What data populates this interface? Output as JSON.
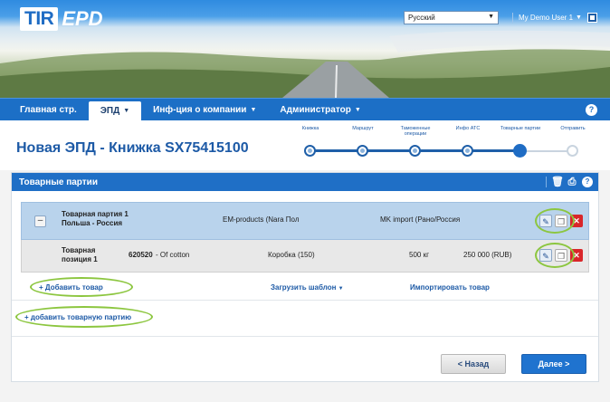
{
  "brand": {
    "logo_tir": "TIR",
    "logo_epd": "EPD"
  },
  "header": {
    "language": "Русский",
    "user_label": "My Demo User 1"
  },
  "nav": {
    "items": [
      {
        "label": "Главная стр.",
        "caret": ""
      },
      {
        "label": "ЭПД",
        "caret": "▼"
      },
      {
        "label": "Инф-ция о компании",
        "caret": "▼"
      },
      {
        "label": "Администратор",
        "caret": "▼"
      }
    ],
    "help": "?"
  },
  "page": {
    "title": "Новая ЭПД - Книжка SX75415100"
  },
  "stepper": {
    "steps": [
      {
        "label": "Книжка"
      },
      {
        "label": "Маршрут"
      },
      {
        "label": "Таможенные операции"
      },
      {
        "label": "Инфо АТС"
      },
      {
        "label": "Товарные партии"
      },
      {
        "label": "Отправить"
      }
    ],
    "current_step": 5
  },
  "panel": {
    "title": "Товарные партии",
    "help": "?"
  },
  "batch": {
    "collapse": "–",
    "name_line1": "Товарная партия 1",
    "name_line2": "Польша - Россия",
    "sender": "EM-products (Nara Пол",
    "receiver": "MK import (Рано/Россия"
  },
  "item": {
    "name_line1": "Товарная",
    "name_line2": "позиция 1",
    "code": "620520",
    "desc": "- Of cotton",
    "packaging": "Коробка (150)",
    "weight": "500 кг",
    "value": "250 000 (RUB)"
  },
  "links": {
    "add_item": "+ Добавить товар",
    "load_template": "Загрузить шаблон",
    "load_template_caret": "▼",
    "import_item": "Импортировать товар",
    "add_batch": "+ добавить товарную партию"
  },
  "buttons": {
    "back": "< Назад",
    "next": "Далее >"
  },
  "colors": {
    "nav": "#1c6fc6",
    "title": "#1d5aa6",
    "highlight": "#8cc63f",
    "delete": "#d9262a"
  }
}
